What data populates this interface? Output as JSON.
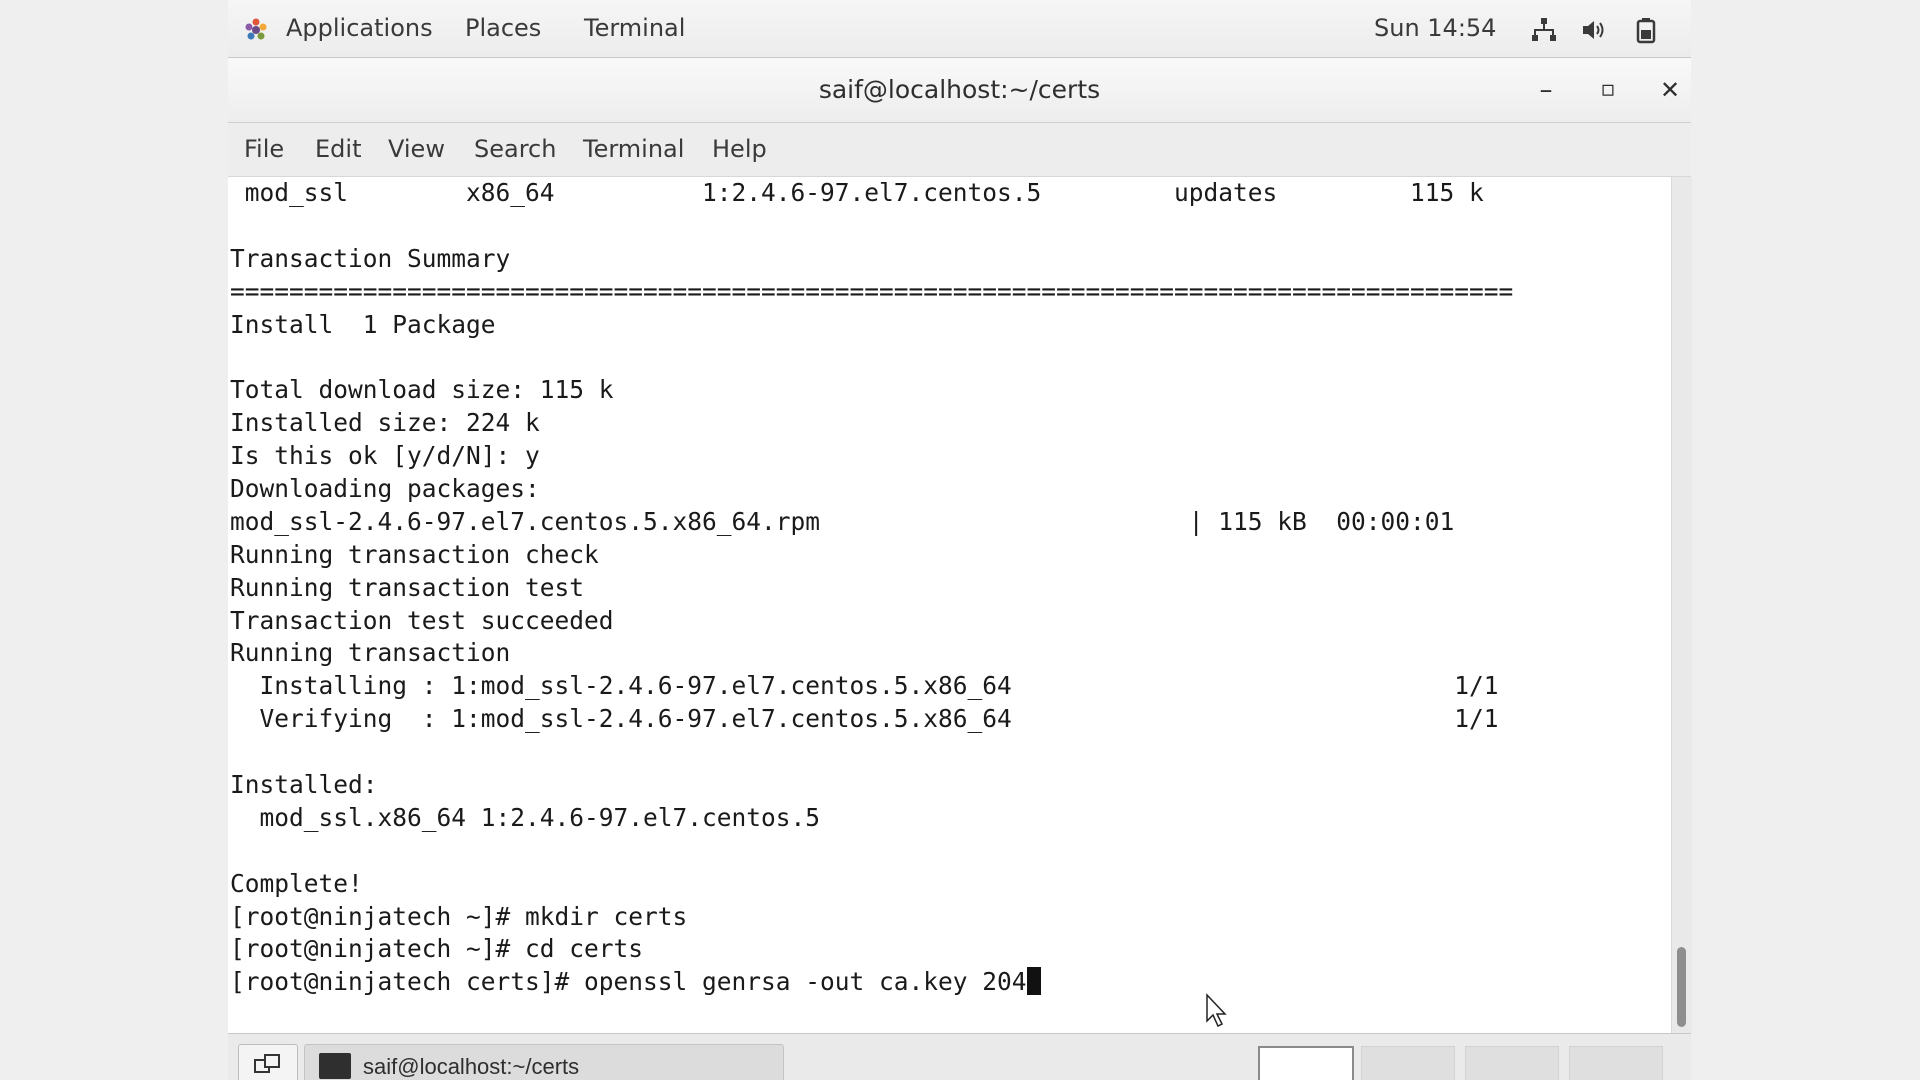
{
  "top_panel": {
    "applications": "Applications",
    "places": "Places",
    "terminal": "Terminal",
    "clock": "Sun 14:54",
    "icons": [
      "network-icon",
      "volume-icon",
      "battery-icon"
    ]
  },
  "window": {
    "title": "saif@localhost:~/certs",
    "minimize": "–",
    "maximize": "▫",
    "close": "✕"
  },
  "menubar": {
    "items": [
      "File",
      "Edit",
      "View",
      "Search",
      "Terminal",
      "Help"
    ]
  },
  "terminal": {
    "lines": [
      " mod_ssl        x86_64          1:2.4.6-97.el7.centos.5         updates         115 k",
      "",
      "Transaction Summary",
      "=======================================================================================",
      "Install  1 Package",
      "",
      "Total download size: 115 k",
      "Installed size: 224 k",
      "Is this ok [y/d/N]: y",
      "Downloading packages:",
      "mod_ssl-2.4.6-97.el7.centos.5.x86_64.rpm                         | 115 kB  00:00:01",
      "Running transaction check",
      "Running transaction test",
      "Transaction test succeeded",
      "Running transaction",
      "  Installing : 1:mod_ssl-2.4.6-97.el7.centos.5.x86_64                              1/1",
      "  Verifying  : 1:mod_ssl-2.4.6-97.el7.centos.5.x86_64                              1/1",
      "",
      "Installed:",
      "  mod_ssl.x86_64 1:2.4.6-97.el7.centos.5",
      "",
      "Complete!",
      "[root@ninjatech ~]# mkdir certs",
      "[root@ninjatech ~]# cd certs"
    ],
    "prompt_line": "[root@ninjatech certs]# openssl genrsa -out ca.key 204"
  },
  "taskbar": {
    "task_label": "saif@localhost:~/certs"
  }
}
